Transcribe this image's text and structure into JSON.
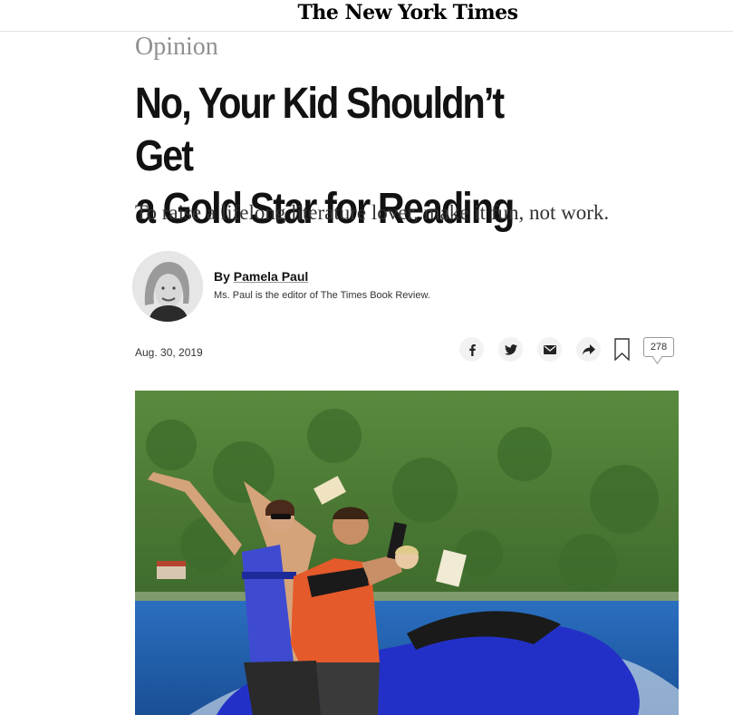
{
  "masthead": {
    "logo": "The New York Times"
  },
  "article": {
    "section": "Opinion",
    "headline_line1": "No, Your Kid Shouldn’t Get",
    "headline_line2": "a Gold Star for Reading",
    "summary": "To raise a lifelong literature lover, make it fun, not work.",
    "byline_prefix": "By ",
    "author": "Pamela Paul",
    "author_bio": "Ms. Paul is the editor of The Times Book Review.",
    "date": "Aug. 30, 2019",
    "comment_count": "278"
  },
  "share": {
    "icons": [
      "facebook-icon",
      "twitter-icon",
      "email-icon",
      "share-arrow-icon",
      "bookmark-icon",
      "comment-icon"
    ]
  },
  "colors": {
    "section_gray": "#909090",
    "icon_bg": "#f2f2f2",
    "hill_green": "#3e6e2c",
    "sea_blue": "#1f5fb0",
    "jetski_blue": "#2330c8"
  }
}
